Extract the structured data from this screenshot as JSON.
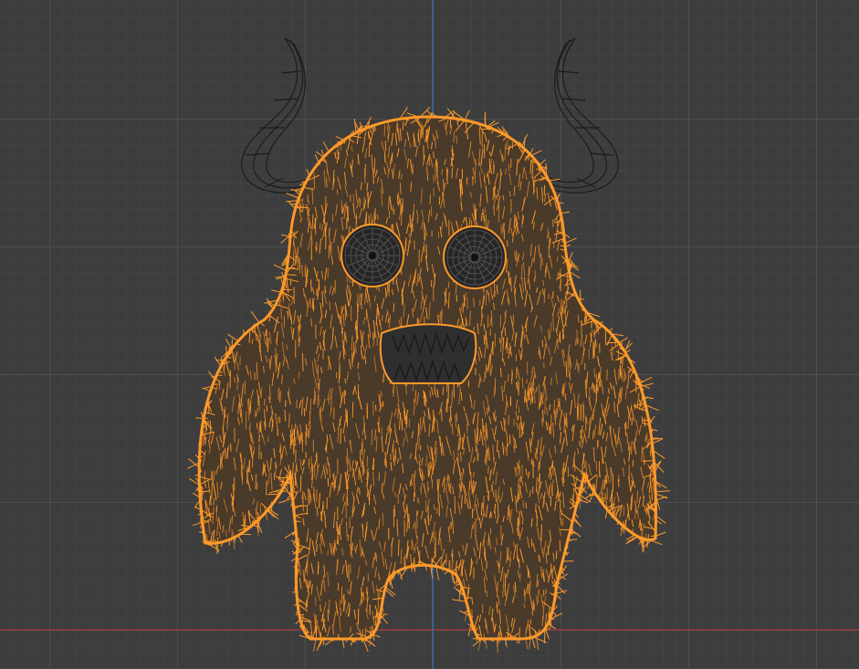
{
  "viewport": {
    "background_color": "#3d3d3d",
    "grid_color": "#4b4b4b",
    "axis_x_color": "#9b3a3a",
    "axis_y_color": "#3a6aa8"
  },
  "model": {
    "name": "furry monster",
    "fur_color": "#ff9a2a",
    "wire_color": "#1a1a1a",
    "horn_count": 2,
    "eye_count": 2
  }
}
